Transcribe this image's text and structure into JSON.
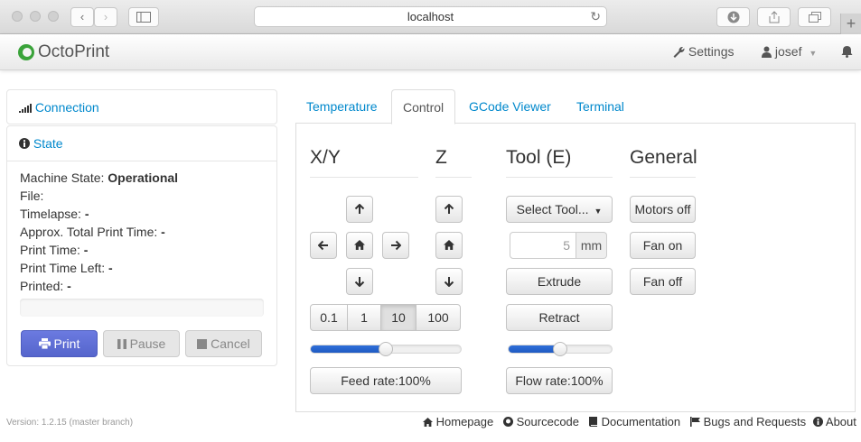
{
  "browser": {
    "url": "localhost"
  },
  "navbar": {
    "brand": "OctoPrint",
    "settings_label": "Settings",
    "user_label": "josef"
  },
  "sidebar": {
    "connection_title": "Connection",
    "state_title": "State",
    "state": {
      "machine_state_label": "Machine State:",
      "machine_state_value": "Operational",
      "file_label": "File:",
      "timelapse_label": "Timelapse:",
      "timelapse_value": "-",
      "approx_label": "Approx. Total Print Time:",
      "approx_value": "-",
      "print_time_label": "Print Time:",
      "print_time_value": "-",
      "print_time_left_label": "Print Time Left:",
      "print_time_left_value": "-",
      "printed_label": "Printed:",
      "printed_value": "-",
      "progress": 0
    },
    "buttons": {
      "print": "Print",
      "pause": "Pause",
      "cancel": "Cancel"
    }
  },
  "tabs": [
    "Temperature",
    "Control",
    "GCode Viewer",
    "Terminal"
  ],
  "active_tab": "Control",
  "control": {
    "headings": {
      "xy": "X/Y",
      "z": "Z",
      "tool": "Tool (E)",
      "general": "General"
    },
    "step_sizes": [
      "0.1",
      "1",
      "10",
      "100"
    ],
    "active_step": "10",
    "feed_rate_label": "Feed rate:100%",
    "feed_rate_value": 0.5,
    "select_tool_label": "Select Tool...",
    "extrude_amount": "5",
    "extrude_unit": "mm",
    "extrude_label": "Extrude",
    "retract_label": "Retract",
    "flow_rate_label": "Flow rate:100%",
    "flow_rate_value": 0.5,
    "motors_off_label": "Motors off",
    "fan_on_label": "Fan on",
    "fan_off_label": "Fan off"
  },
  "footer": {
    "version": "Version: 1.2.15 (master branch)",
    "links": [
      "Homepage",
      "Sourcecode",
      "Documentation",
      "Bugs and Requests",
      "About"
    ]
  },
  "colors": {
    "link": "#0088cc",
    "primary_button": "#5f6fd6",
    "slider_fill": "#2f6fd9",
    "brand_logo": "#3aa33a"
  }
}
